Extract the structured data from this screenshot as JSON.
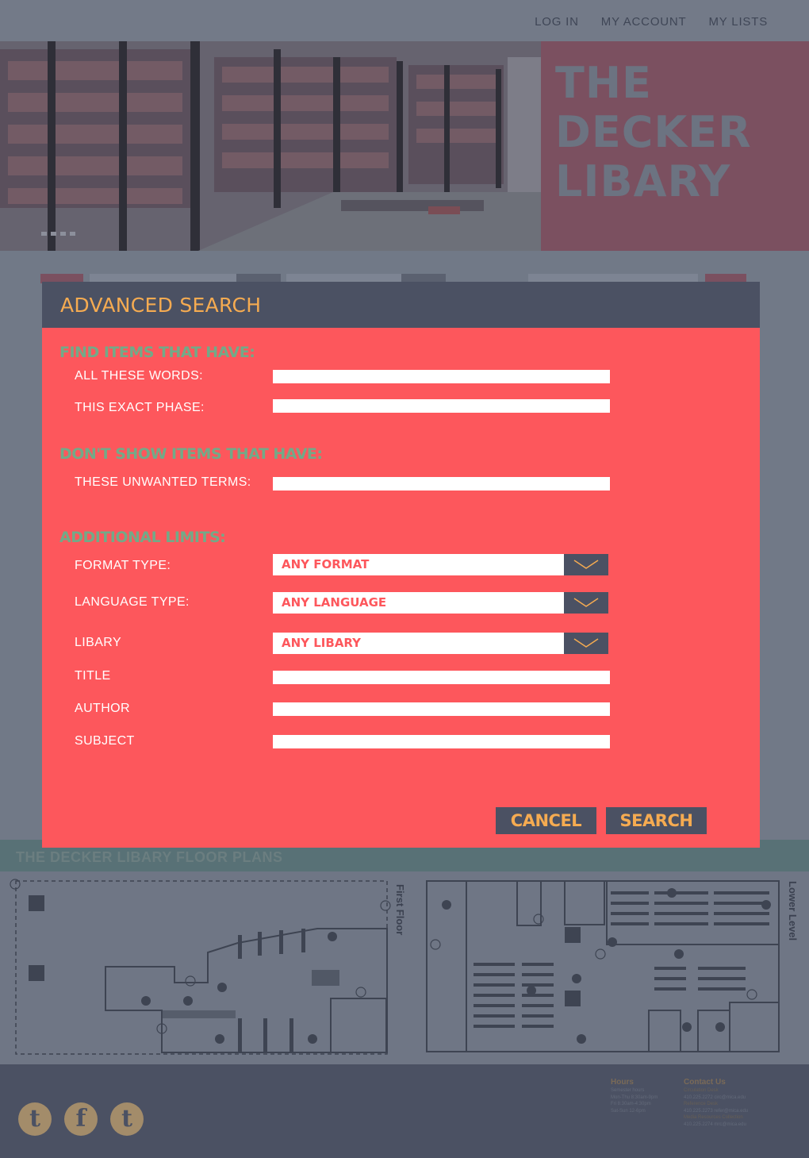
{
  "topnav": {
    "login": "LOG IN",
    "account": "MY ACCOUNT",
    "lists": "MY LISTS"
  },
  "hero": {
    "title_line1": "THE",
    "title_line2": "DECKER",
    "title_line3": "LIBARY"
  },
  "floor_plans": {
    "title": "THE DECKER LIBARY FLOOR PLANS",
    "first_label": "First Floor",
    "lower_label": "Lower Level"
  },
  "footer": {
    "hours_title": "Hours",
    "hours_lines": [
      "Semester hours",
      "Mon-Thu 8:30am-9pm",
      "Fri 8:30am-4:30pm",
      "Sat-Sun 12-6pm"
    ],
    "contact_title": "Contact Us",
    "contact_lines": [
      "Circulation Desk",
      "410.225.2272 circ@mica.edu",
      "Reference Desk",
      "410.225.2273 refer@mica.edu",
      "Media Resources Collection",
      "410.225.2274 mrc@mica.edu"
    ],
    "social": {
      "twitter": "t",
      "facebook": "f",
      "tumblr": "t"
    }
  },
  "modal": {
    "title": "ADVANCED SEARCH",
    "section_find": "FIND ITEMS THAT HAVE:",
    "label_all_words": "ALL THESE WORDS:",
    "label_exact_phrase": "THIS EXACT PHASE:",
    "section_dont_show": "DON'T SHOW ITEMS THAT HAVE:",
    "label_unwanted": "THESE UNWANTED TERMS:",
    "section_limits": "ADDITIONAL LIMITS:",
    "label_format": "FORMAT TYPE:",
    "format_value": "ANY FORMAT",
    "label_language": "LANGUAGE TYPE:",
    "language_value": "ANY LANGUAGE",
    "label_library": "LIBARY",
    "library_value": "ANY LIBARY",
    "label_title": "TITLE",
    "label_author": "AUTHOR",
    "label_subject": "SUBJECT",
    "inputs": {
      "all_words": "",
      "exact_phrase": "",
      "unwanted": "",
      "title": "",
      "author": "",
      "subject": ""
    },
    "cancel_label": "CANCEL",
    "search_label": "SEARCH"
  },
  "colors": {
    "modal_bg": "#fd575c",
    "header_bg": "#4b5163",
    "accent_orange": "#f5ab51",
    "section_green": "#72aa88"
  }
}
